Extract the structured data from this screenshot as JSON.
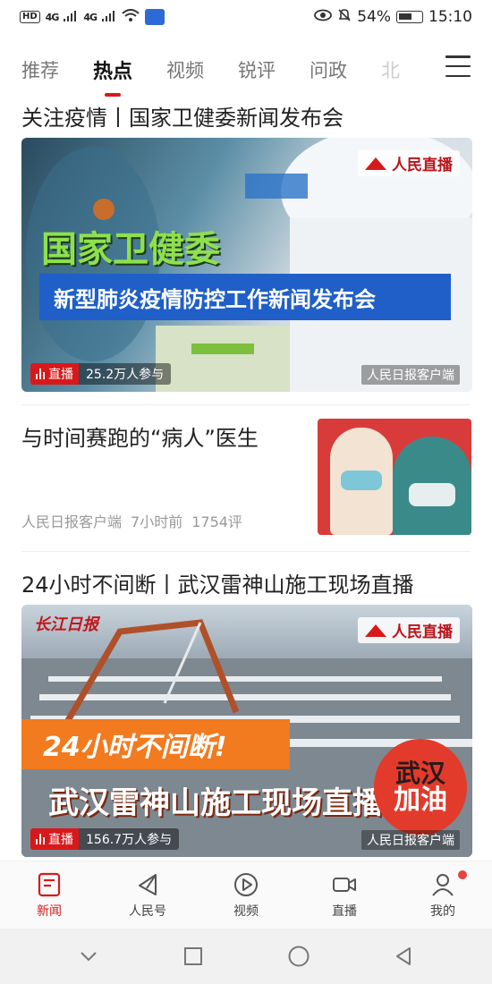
{
  "status_bar": {
    "hd": "HD",
    "signal_1": "4G",
    "signal_2": "4G",
    "battery": "54%",
    "time": "15:10"
  },
  "tabs": [
    {
      "label": "推荐",
      "active": false
    },
    {
      "label": "热点",
      "active": true
    },
    {
      "label": "视频",
      "active": false
    },
    {
      "label": "锐评",
      "active": false
    },
    {
      "label": "问政",
      "active": false
    },
    {
      "label": "北",
      "active": false
    }
  ],
  "feed": {
    "card1": {
      "headline": "关注疫情丨国家卫健委新闻发布会",
      "live_brand": "人民直播",
      "overlay_green": "国家卫健委",
      "overlay_band": "新型肺炎疫情防控工作新闻发布会",
      "live_tag": "直播",
      "participants": "25.2万人参与",
      "source": "人民日报客户端"
    },
    "article": {
      "title": "与时间赛跑的“病人”医生",
      "source": "人民日报客户端",
      "time_ago": "7小时前",
      "comments": "1754评"
    },
    "card2": {
      "headline": "24小时不间断丨武汉雷神山施工现场直播",
      "paper_logo": "长江日报",
      "live_brand": "人民直播",
      "overlay_orange": "24小时不间断!",
      "overlay_title": "武汉雷神山施工现场直播",
      "seal_line1": "武汉",
      "seal_line2": "加油",
      "live_tag": "直播",
      "participants": "156.7万人参与",
      "source": "人民日报客户端"
    }
  },
  "bottom_nav": [
    {
      "label": "新闻",
      "icon": "news-icon",
      "active": true
    },
    {
      "label": "人民号",
      "icon": "paper-plane-icon",
      "active": false
    },
    {
      "label": "视频",
      "icon": "play-icon",
      "active": false
    },
    {
      "label": "直播",
      "icon": "video-camera-icon",
      "active": false
    },
    {
      "label": "我的",
      "icon": "user-icon",
      "active": false,
      "badge_dot": true
    }
  ],
  "colors": {
    "brand_red": "#d8191b",
    "band_blue": "#1f5fc7",
    "accent_green": "#8fe04d",
    "accent_orange": "#f27a1f"
  }
}
